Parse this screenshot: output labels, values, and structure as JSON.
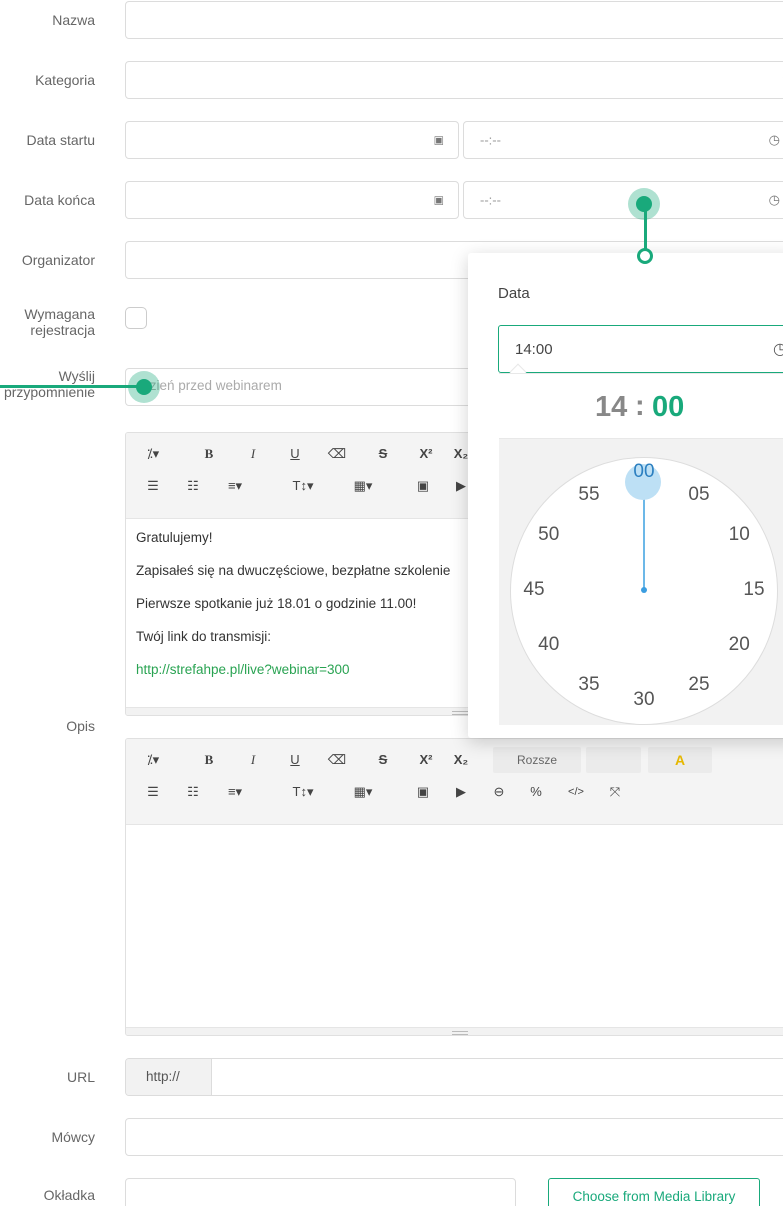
{
  "form": {
    "name_label": "Nazwa",
    "category_label": "Kategoria",
    "start_label": "Data startu",
    "end_label": "Data końca",
    "organizer_label": "Organizator",
    "registration_label_1": "Wymagana",
    "registration_label_2": "rejestracja",
    "reminder_label_1": "Wyślij",
    "reminder_label_2": "przypomnienie",
    "reminder_placeholder": "Dzień przed webinarem",
    "description_label": "Opis",
    "url_label": "URL",
    "url_prefix": "http://",
    "speakers_label": "Mówcy",
    "cover_label": "Okładka",
    "media_button": "Choose from Media Library",
    "time_placeholder": "--:--"
  },
  "editor_content": [
    "Gratulujemy!",
    "Zapisałeś się na dwuczęściowe, bezpłatne szkolenie",
    "Pierwsze spotkanie już 18.01 o godzinie 11.00!",
    "Twój link do transmisji:",
    "http://strefahpe.pl/live?webinar=300"
  ],
  "toolbar": {
    "magic": "⁒▾",
    "bold": "B",
    "italic": "I",
    "underline": "U",
    "eraser": "⌫",
    "strike": "S",
    "sup": "X²",
    "sub": "X₂",
    "ul": "☰",
    "ol": "☷",
    "align": "≡▾",
    "fontsize": "T↕▾",
    "table": "▦▾",
    "image": "▣",
    "video": "▶",
    "link": "⊖",
    "unlink": "%",
    "code": "</>",
    "fullscreen": "⤧",
    "partial_label": "Rozsze"
  },
  "picker": {
    "title": "Data",
    "value": "14:00",
    "hour": "14",
    "sep": ":",
    "minute": "00",
    "minutes": [
      "00",
      "05",
      "10",
      "15",
      "20",
      "25",
      "30",
      "35",
      "40",
      "45",
      "50",
      "55"
    ]
  },
  "colors": {
    "accent": "#19a97b",
    "link": "#29a352"
  }
}
